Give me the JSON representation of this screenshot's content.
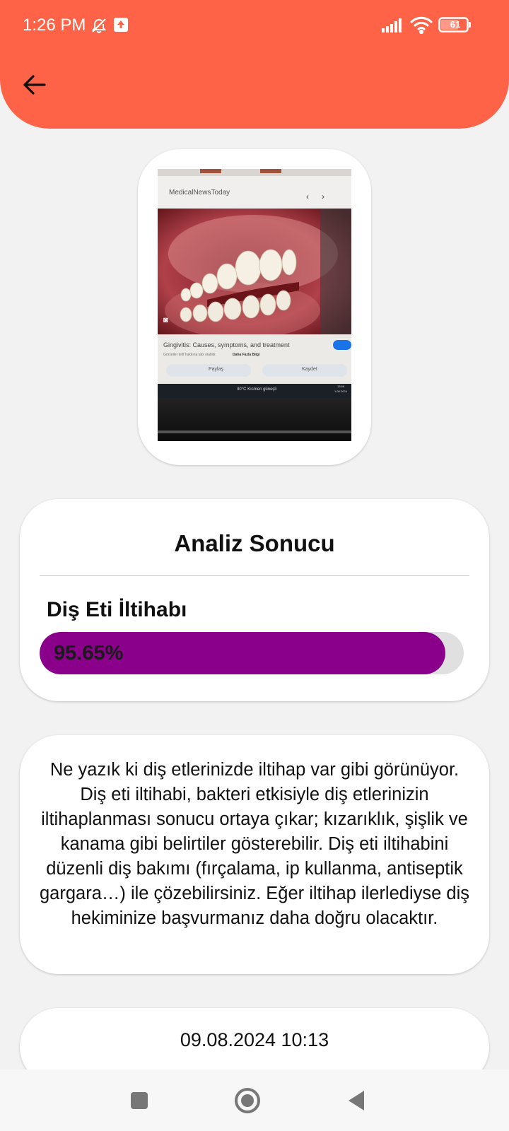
{
  "status_bar": {
    "time": "1:26 PM",
    "battery": "61",
    "icons": [
      "bell-muted-icon",
      "upload-notification-icon",
      "signal-icon",
      "wifi-icon",
      "battery-icon"
    ]
  },
  "header": {
    "back_icon": "arrow-left-icon",
    "color": "#ff6347"
  },
  "photo": {
    "site_name": "MedicalNewsToday",
    "article_title": "Gingivitis: Causes, symptoms, and treatment",
    "caption_line": "Görseller telif hakkına tabi olabilir.",
    "caption_link": "Daha Fazla Bilgi",
    "share_label": "Paylaş",
    "save_label": "Kaydet",
    "taskbar_weather": "30°C  Kısmen güneşli",
    "taskbar_time": "13:56",
    "taskbar_date": "1.08.2024"
  },
  "result": {
    "title": "Analiz Sonucu",
    "condition": "Diş Eti İltihabı",
    "confidence_label": "95.65%",
    "confidence": 0.9565,
    "bar_color": "#8b008b"
  },
  "description": "Ne yazık ki diş etlerinizde iltihap var gibi görünüyor. Diş eti iltihabi, bakteri etkisiyle diş etlerinizin iltihaplanması sonucu ortaya çıkar; kızarıklık, şişlik ve kanama gibi belirtiler gösterebilir. Diş eti iltihabini düzenli diş bakımı (fırçalama, ip kullanma, antiseptik gargara…) ile çözebilirsiniz. Eğer iltihap ilerlediyse diş hekiminize başvurmanız daha doğru olacaktır.",
  "date": "09.08.2024 10:13",
  "nav": [
    "recent-apps-icon",
    "home-icon",
    "back-triangle-icon"
  ]
}
